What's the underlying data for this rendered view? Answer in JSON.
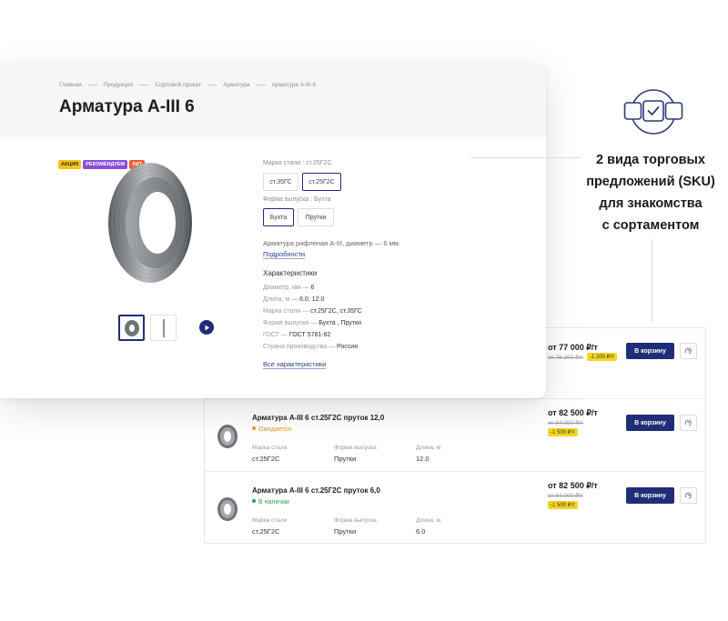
{
  "product": {
    "breadcrumb": [
      "Главная",
      "Продукция",
      "Сортовой прокат",
      "Арматура",
      "Арматура A-III 6"
    ],
    "title": "Арматура A-III 6",
    "badges": [
      {
        "label": "АКЦИЯ",
        "color": "#f5c518",
        "text_color": "#333333"
      },
      {
        "label": "РЕКОМЕНДУЕМ",
        "color": "#8a4fd8",
        "text_color": "#ffffff"
      },
      {
        "label": "ХИТ",
        "color": "#ef5b2a",
        "text_color": "#ffffff"
      }
    ],
    "video_icon": "play-icon",
    "sku": {
      "steel_label": "Марка стали : ст.25Г2С",
      "steel_options": [
        "ст.35ГС",
        "ст.25Г2С"
      ],
      "steel_selected": "ст.25Г2С",
      "form_label": "Форма выпуска : Бухта",
      "form_options": [
        "Бухта",
        "Прутки"
      ],
      "form_selected": "Бухта"
    },
    "description": "Арматура рифленая A-III, диаметр — 6 мм.",
    "more_link": "Подробности",
    "characteristics_title": "Характеристики",
    "characteristics": [
      {
        "name": "Диаметр, мм",
        "value": "6"
      },
      {
        "name": "Длина, м",
        "value": "6.0, 12.0"
      },
      {
        "name": "Марка стали",
        "value": "ст.25Г2С, ст.35ГС"
      },
      {
        "name": "Форма выпуска",
        "value": "Бухта , Прутки"
      },
      {
        "name": "ГОСТ",
        "value": "ГОСТ 5781-82"
      },
      {
        "name": "Страна производства",
        "value": "Россия"
      }
    ],
    "all_chars_link": "Все характеристики"
  },
  "offers": {
    "headers": {
      "steel": "Марка стали",
      "form": "Форма выпуска",
      "length": "Длина, м"
    },
    "cart_label": "В корзину",
    "compare_icon": "compare-icon",
    "items": [
      {
        "title": "",
        "status": "",
        "steel": "",
        "form": "",
        "length": "",
        "price": "от 77 000 ₽/т",
        "old_price": "от 78 200 ₽/т",
        "discount": "-1 200 ₽/т"
      },
      {
        "title": "Арматура A-III 6 ст.25Г2С пруток 12,0",
        "status": "Ожидается",
        "status_type": "wait",
        "steel": "ст.25Г2С",
        "form": "Прутки",
        "length": "12.0",
        "price": "от 82 500 ₽/т",
        "old_price": "от 84 000 ₽/т",
        "discount": "-1 500 ₽/т"
      },
      {
        "title": "Арматура A-III 6 ст.25Г2С пруток 6,0",
        "status": "В наличии",
        "status_type": "stock",
        "steel": "ст.25Г2С",
        "form": "Прутки",
        "length": "6.0",
        "price": "от 82 500 ₽/т",
        "old_price": "от 84 000 ₽/т",
        "discount": "-1 500 ₽/т"
      }
    ]
  },
  "callout": {
    "icon": "sku-options-icon",
    "lines": [
      "2 вида торговых",
      "предложений (SKU)",
      "для знакомства",
      "с сортаментом"
    ]
  },
  "colors": {
    "accent": "#1f2e76",
    "discount": "#f6d61e",
    "wait": "#e09a24",
    "stock": "#2f9e48"
  }
}
